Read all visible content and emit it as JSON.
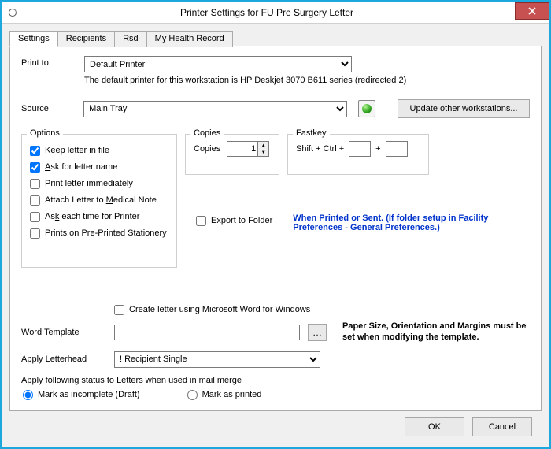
{
  "window": {
    "title": "Printer Settings for FU Pre Surgery Letter"
  },
  "tabs": {
    "items": [
      "Settings",
      "Recipients",
      "Rsd",
      "My Health Record"
    ],
    "active": 0
  },
  "printTo": {
    "label": "Print to",
    "selected": "Default Printer",
    "note": "The default printer for this workstation is HP Deskjet 3070 B611 series (redirected 2)"
  },
  "source": {
    "label": "Source",
    "selected": "Main Tray"
  },
  "updateBtn": "Update other workstations...",
  "optionsGroup": {
    "title": "Options",
    "items": [
      {
        "label_pre": "",
        "label_u": "K",
        "label_post": "eep letter in file",
        "checked": true
      },
      {
        "label_pre": "",
        "label_u": "A",
        "label_post": "sk for letter name",
        "checked": true
      },
      {
        "label_pre": "",
        "label_u": "P",
        "label_post": "rint letter immediately",
        "checked": false
      },
      {
        "label_pre": "Attach Letter to ",
        "label_u": "M",
        "label_post": "edical Note",
        "checked": false
      },
      {
        "label_pre": "As",
        "label_u": "k",
        "label_post": " each time for Printer",
        "checked": false
      },
      {
        "label_pre": "Prints on Pre-Printed Stationery",
        "label_u": "",
        "label_post": "",
        "checked": false
      }
    ]
  },
  "copiesGroup": {
    "title": "Copies",
    "label": "Copies",
    "value": "1"
  },
  "fastkeyGroup": {
    "title": "Fastkey",
    "label": "Shift + Ctrl +",
    "val1": "",
    "plus": "+",
    "val2": ""
  },
  "exportFolder": {
    "label_pre": "",
    "label_u": "E",
    "label_post": "xport to Folder",
    "checked": false,
    "note": "When Printed or Sent. (If folder setup in Facility Preferences - General Preferences.)"
  },
  "createWord": {
    "checked": false,
    "label": "Create letter using Microsoft Word for Windows"
  },
  "wordTemplate": {
    "label_u": "W",
    "label_post": "ord Template",
    "value": ""
  },
  "applyLetterhead": {
    "label": "Apply Letterhead",
    "selected": "! Recipient Single"
  },
  "mergeStatus": {
    "heading": "Apply following status to Letters when used in mail merge",
    "options": [
      {
        "label": "Mark as incomplete (Draft)",
        "selected": true
      },
      {
        "label": "Mark as printed",
        "selected": false
      }
    ]
  },
  "paperNote": "Paper Size, Orientation and Margins must be set when modifying the template.",
  "buttons": {
    "ok": "OK",
    "cancel": "Cancel"
  }
}
